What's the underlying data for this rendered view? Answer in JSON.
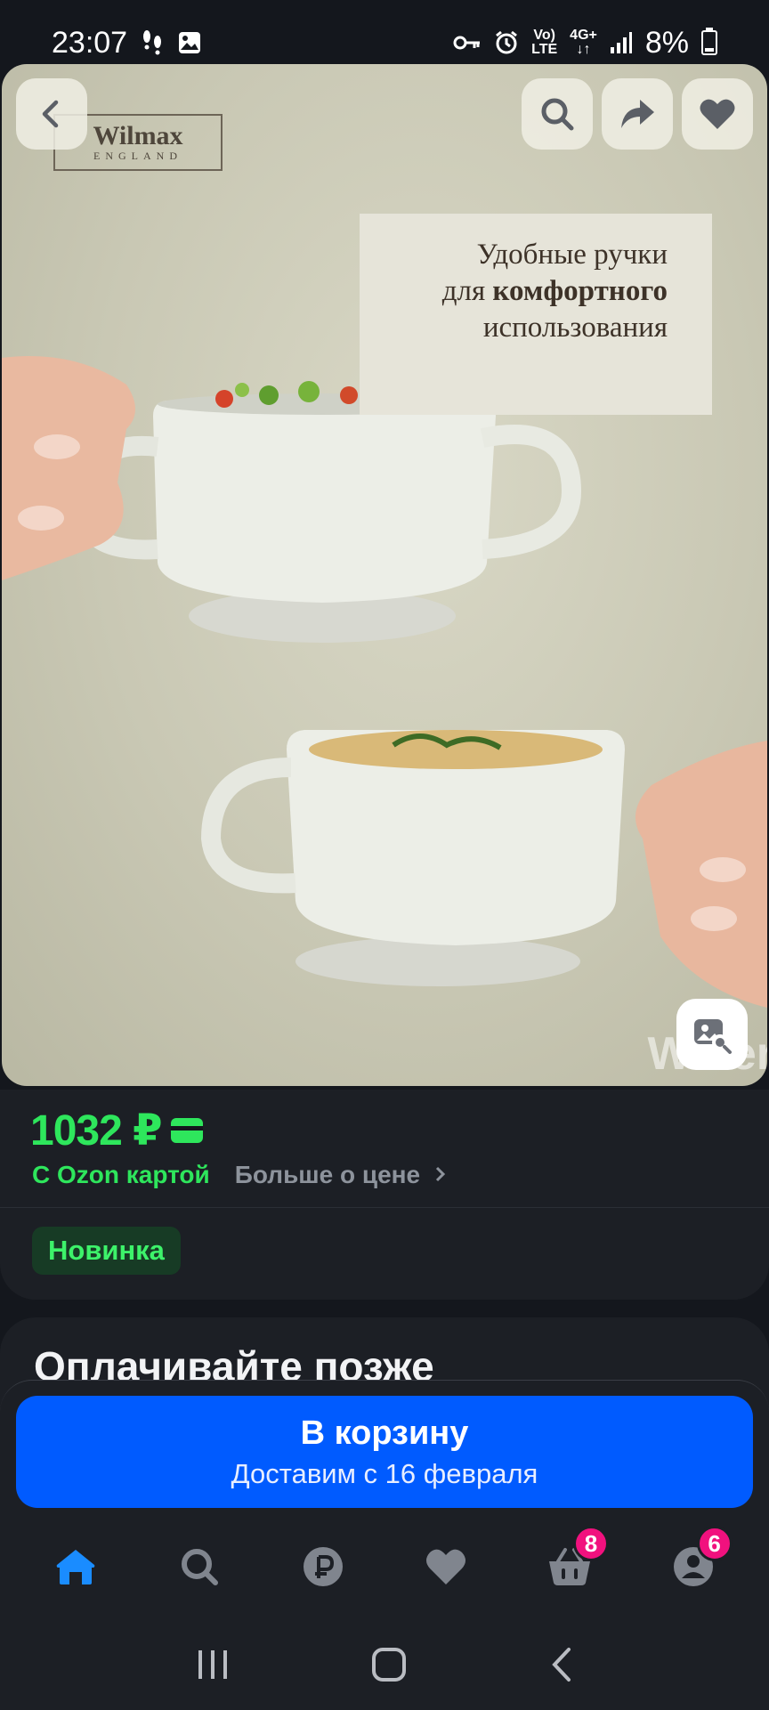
{
  "status_bar": {
    "time": "23:07",
    "battery": "8%",
    "network_top": "Vo)",
    "network_bottom": "LTE",
    "gen_top": "4G+",
    "gen_bottom": "↓↑"
  },
  "hero": {
    "logo_main": "Wilmax",
    "logo_sub": "ENGLAND",
    "promo_line1": "Удобные ручки",
    "promo_line2_prefix": "для ",
    "promo_line2_bold": "комфортного",
    "promo_line3": "использования",
    "watermark": "Water"
  },
  "product": {
    "price": "1032 ₽",
    "ozon_card_label": "С Ozon картой",
    "more_price_label": "Больше о цене",
    "badge": "Новинка"
  },
  "pay_later": {
    "title": "Оплачивайте позже"
  },
  "cart_button": {
    "label": "В корзину",
    "sub_label": "Доставим с 16 февраля"
  },
  "bottom_nav": {
    "items": [
      {
        "name": "home-icon",
        "active": true
      },
      {
        "name": "search-icon"
      },
      {
        "name": "ruble-icon"
      },
      {
        "name": "heart-icon"
      },
      {
        "name": "basket-icon",
        "badge": "8"
      },
      {
        "name": "profile-icon",
        "badge": "6"
      }
    ]
  },
  "colors": {
    "accent_blue": "#005bff",
    "price_green": "#2ee65c",
    "badge_pink": "#f1117e",
    "background": "#14171d"
  }
}
